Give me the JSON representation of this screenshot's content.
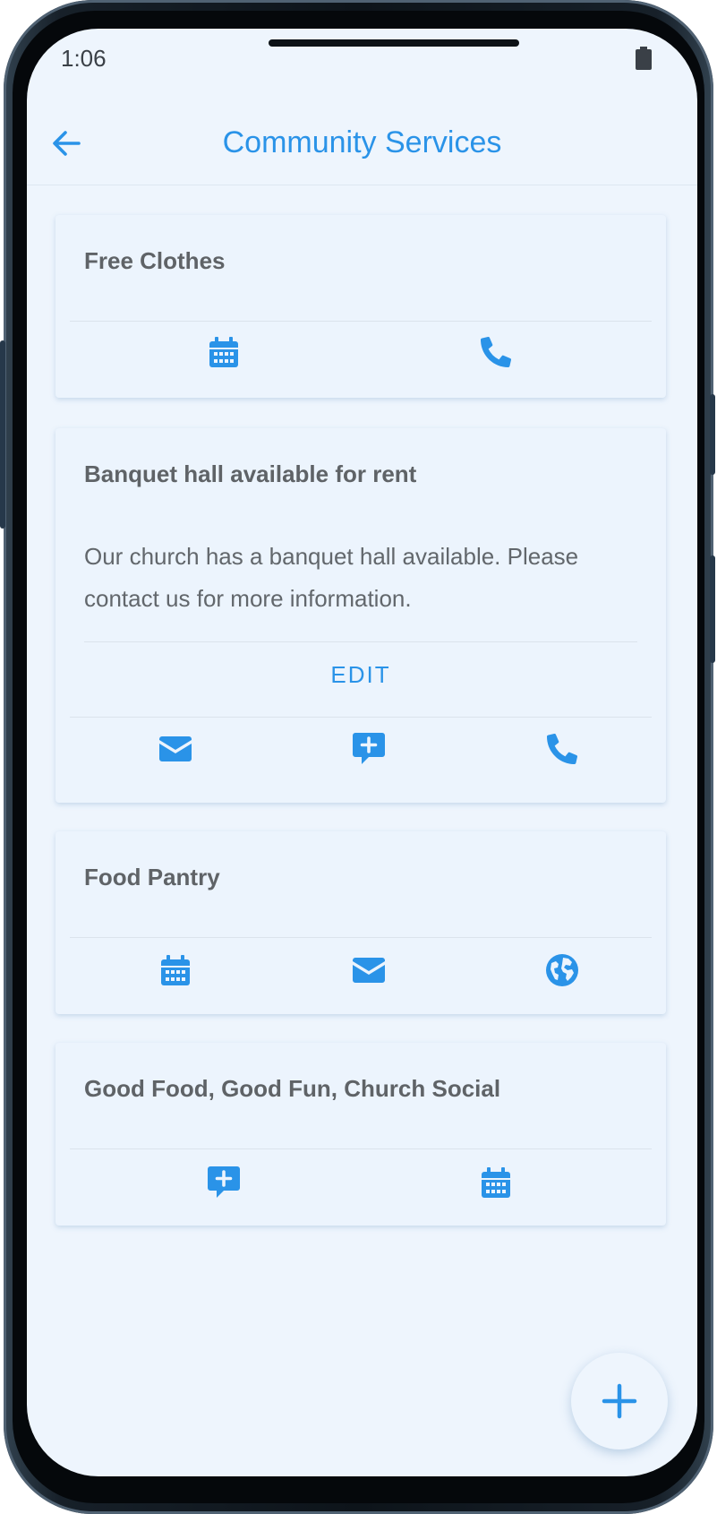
{
  "status_bar": {
    "time": "1:06"
  },
  "header": {
    "title": "Community Services"
  },
  "colors": {
    "accent": "#2a93e8",
    "background": "#eef5fd"
  },
  "cards": [
    {
      "title": "Free Clothes",
      "actions": [
        "calendar-icon",
        "phone-icon"
      ]
    },
    {
      "title": "Banquet hall available for rent",
      "description": "Our church has a banquet hall available. Please contact us for more information.",
      "edit_label": "EDIT",
      "actions": [
        "envelope-icon",
        "comment-plus-icon",
        "phone-icon"
      ]
    },
    {
      "title": "Food Pantry",
      "actions": [
        "calendar-icon",
        "envelope-icon",
        "globe-icon"
      ]
    },
    {
      "title": "Good Food, Good Fun, Church Social",
      "actions": [
        "comment-plus-icon",
        "calendar-icon"
      ]
    }
  ],
  "fab": {
    "icon": "plus-icon"
  }
}
